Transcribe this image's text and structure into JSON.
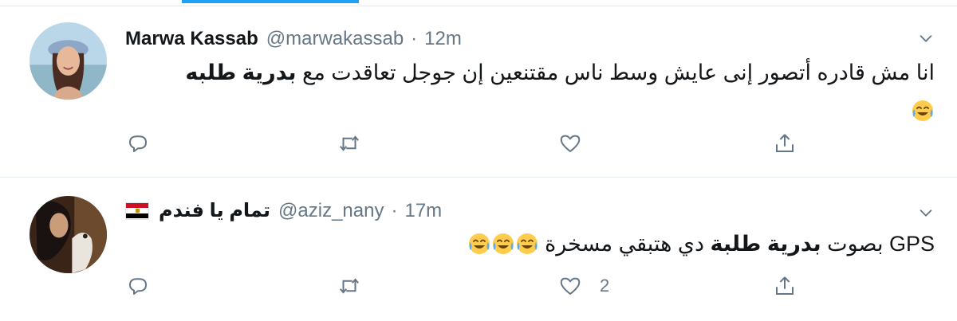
{
  "tweets": [
    {
      "author_name": "Marwa Kassab",
      "handle": "@marwakassab",
      "separator": "·",
      "time": "12m",
      "text_plain": "انا مش قادره أتصور إنى عايش وسط ناس مقتنعين إن جوجل تعاقدت مع ",
      "text_bold": "بدرية طلبه",
      "text_after": "",
      "emoji": "face-with-tears-of-joy",
      "emoji_count": 1,
      "like_count": ""
    },
    {
      "author_name": "تمام يا فندم",
      "has_flag": true,
      "flag_icon": "egypt-flag",
      "handle": "@aziz_nany",
      "separator": "·",
      "time": "17m",
      "text_plain": "GPS بصوت ",
      "text_bold": "بدرية طلبة",
      "text_after": " دي هتبقي مسخرة ",
      "emoji": "face-with-tears-of-joy",
      "emoji_count": 3,
      "like_count": "2"
    }
  ],
  "icons": {
    "reply": "reply-icon",
    "retweet": "retweet-icon",
    "like": "heart-icon",
    "share": "share-icon",
    "more": "chevron-down-icon"
  },
  "colors": {
    "accent": "#1da1f2",
    "secondary_text": "#657786",
    "divider": "#e6ecf0"
  }
}
